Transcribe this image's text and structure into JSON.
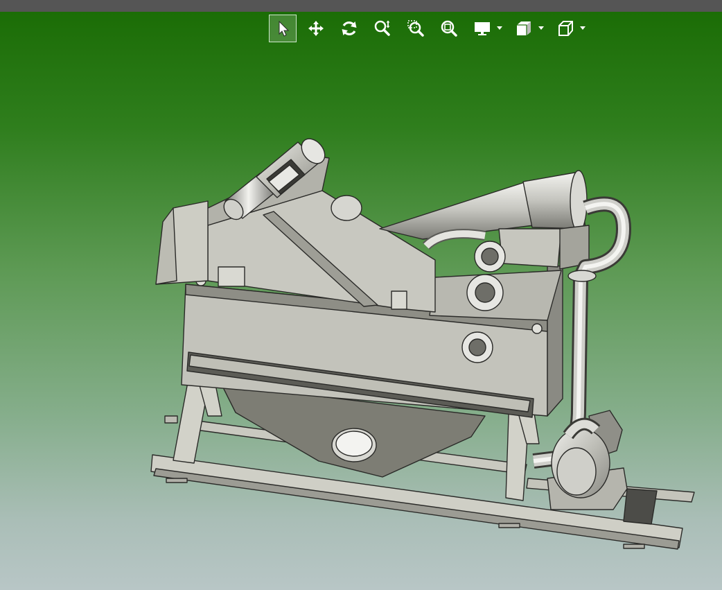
{
  "window": {
    "title_bar_color": "#555555"
  },
  "viewport": {
    "background_top": "#1b6d06",
    "background_bottom": "#b8c6c6",
    "model_name": ""
  },
  "toolbar": {
    "buttons": [
      {
        "id": "select",
        "icon": "select-arrow-icon",
        "active": true
      },
      {
        "id": "pan",
        "icon": "pan-move-icon",
        "active": false
      },
      {
        "id": "rotate",
        "icon": "rotate-icon",
        "active": false
      },
      {
        "id": "zoom",
        "icon": "zoom-icon",
        "active": false
      },
      {
        "id": "zoom-window",
        "icon": "zoom-window-icon",
        "active": false
      },
      {
        "id": "zoom-fit",
        "icon": "zoom-fit-icon",
        "active": false
      },
      {
        "id": "display",
        "icon": "display-monitor-icon",
        "active": false,
        "dropdown": true
      },
      {
        "id": "section",
        "icon": "section-view-icon",
        "active": false,
        "dropdown": true
      },
      {
        "id": "view-orientation",
        "icon": "view-cube-icon",
        "active": false,
        "dropdown": true
      }
    ],
    "icon_color": "#ffffff"
  }
}
